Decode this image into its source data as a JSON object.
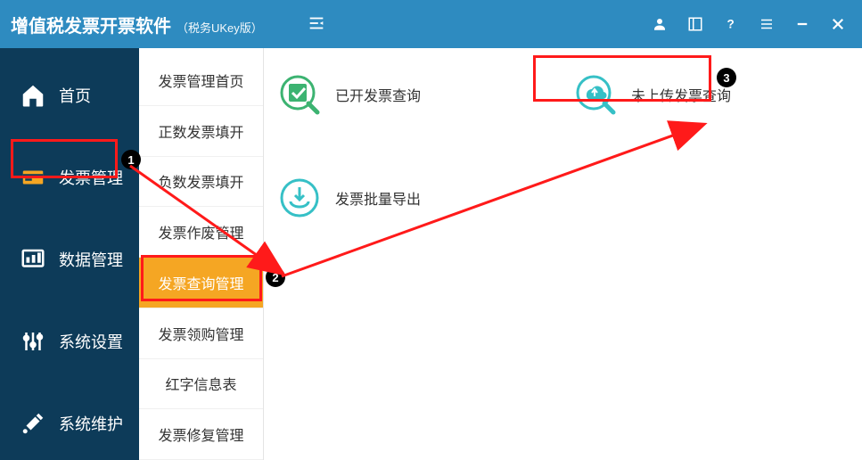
{
  "app": {
    "title": "增值税发票开票软件",
    "subtitle": "（税务UKey版）"
  },
  "titlebar_icons": {
    "collapse": "collapse",
    "user": "user",
    "layout": "layout",
    "help": "?",
    "menu": "menu",
    "minimize": "—",
    "close": "✕"
  },
  "sidebar": {
    "items": [
      {
        "id": "home",
        "label": "首页",
        "icon": "home"
      },
      {
        "id": "invoice",
        "label": "发票管理",
        "icon": "invoice",
        "active": true
      },
      {
        "id": "data",
        "label": "数据管理",
        "icon": "data"
      },
      {
        "id": "settings",
        "label": "系统设置",
        "icon": "settings"
      },
      {
        "id": "maint",
        "label": "系统维护",
        "icon": "maint"
      }
    ]
  },
  "submenu": {
    "items": [
      {
        "label": "发票管理首页"
      },
      {
        "label": "正数发票填开"
      },
      {
        "label": "负数发票填开"
      },
      {
        "label": "发票作废管理"
      },
      {
        "label": "发票查询管理",
        "active": true
      },
      {
        "label": "发票领购管理"
      },
      {
        "label": "红字信息表"
      },
      {
        "label": "发票修复管理"
      }
    ]
  },
  "tiles": [
    {
      "id": "issued-query",
      "label": "已开发票查询",
      "icon": "check",
      "color": "#3cb371"
    },
    {
      "id": "unupload-query",
      "label": "未上传发票查询",
      "icon": "cloud",
      "color": "#36c0c6"
    },
    {
      "id": "batch-export",
      "label": "发票批量导出",
      "icon": "export",
      "color": "#36c0c6"
    }
  ],
  "annotations": {
    "callouts": [
      "1",
      "2",
      "3"
    ]
  }
}
